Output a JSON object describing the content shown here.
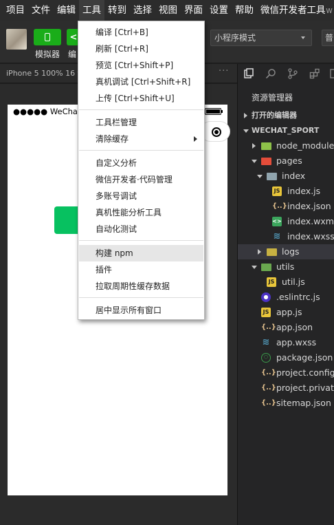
{
  "menubar": {
    "items": [
      "项目",
      "文件",
      "编辑",
      "工具",
      "转到",
      "选择",
      "视图",
      "界面",
      "设置",
      "帮助",
      "微信开发者工具"
    ],
    "clipped": "w"
  },
  "toolbar": {
    "simulator_label": "模拟器",
    "editor_label": "编",
    "mode": "小程序模式",
    "mode2": "普"
  },
  "simulator": {
    "device": "iPhone 5 100% 16 ▾",
    "more": "···",
    "carrier": "●●●●● WeChat"
  },
  "explorer": {
    "title": "资源管理器",
    "open_editors": "打开的编辑器",
    "project": "WECHAT_SPORT",
    "tree": [
      {
        "label": "node_modules",
        "type": "folder-green"
      },
      {
        "label": "pages",
        "type": "folder-red"
      },
      {
        "label": "index",
        "type": "folder-blue"
      },
      {
        "label": "index.js",
        "type": "js"
      },
      {
        "label": "index.json",
        "type": "json"
      },
      {
        "label": "index.wxml",
        "type": "wxml"
      },
      {
        "label": "index.wxss",
        "type": "wxss"
      },
      {
        "label": "logs",
        "type": "folder-yellow"
      },
      {
        "label": "utils",
        "type": "folder-teal"
      },
      {
        "label": "util.js",
        "type": "js"
      },
      {
        "label": ".eslintrc.js",
        "type": "eslint"
      },
      {
        "label": "app.js",
        "type": "js"
      },
      {
        "label": "app.json",
        "type": "json"
      },
      {
        "label": "app.wxss",
        "type": "wxss"
      },
      {
        "label": "package.json",
        "type": "pkg"
      },
      {
        "label": "project.config.j",
        "type": "json"
      },
      {
        "label": "project.private.",
        "type": "json"
      },
      {
        "label": "sitemap.json",
        "type": "json"
      }
    ]
  },
  "tools_menu": {
    "items": [
      {
        "label": "编译  [Ctrl+B]"
      },
      {
        "label": "刷新  [Ctrl+R]"
      },
      {
        "label": "预览  [Ctrl+Shift+P]"
      },
      {
        "label": "真机调试  [Ctrl+Shift+R]"
      },
      {
        "label": "上传  [Ctrl+Shift+U]"
      },
      {
        "label": "工具栏管理"
      },
      {
        "label": "清除缓存"
      },
      {
        "label": "自定义分析"
      },
      {
        "label": "微信开发者·代码管理"
      },
      {
        "label": "多账号调试"
      },
      {
        "label": "真机性能分析工具"
      },
      {
        "label": "自动化测试"
      },
      {
        "label": "构建 npm"
      },
      {
        "label": "插件"
      },
      {
        "label": "拉取周期性缓存数据"
      },
      {
        "label": "居中显示所有窗口"
      }
    ]
  }
}
